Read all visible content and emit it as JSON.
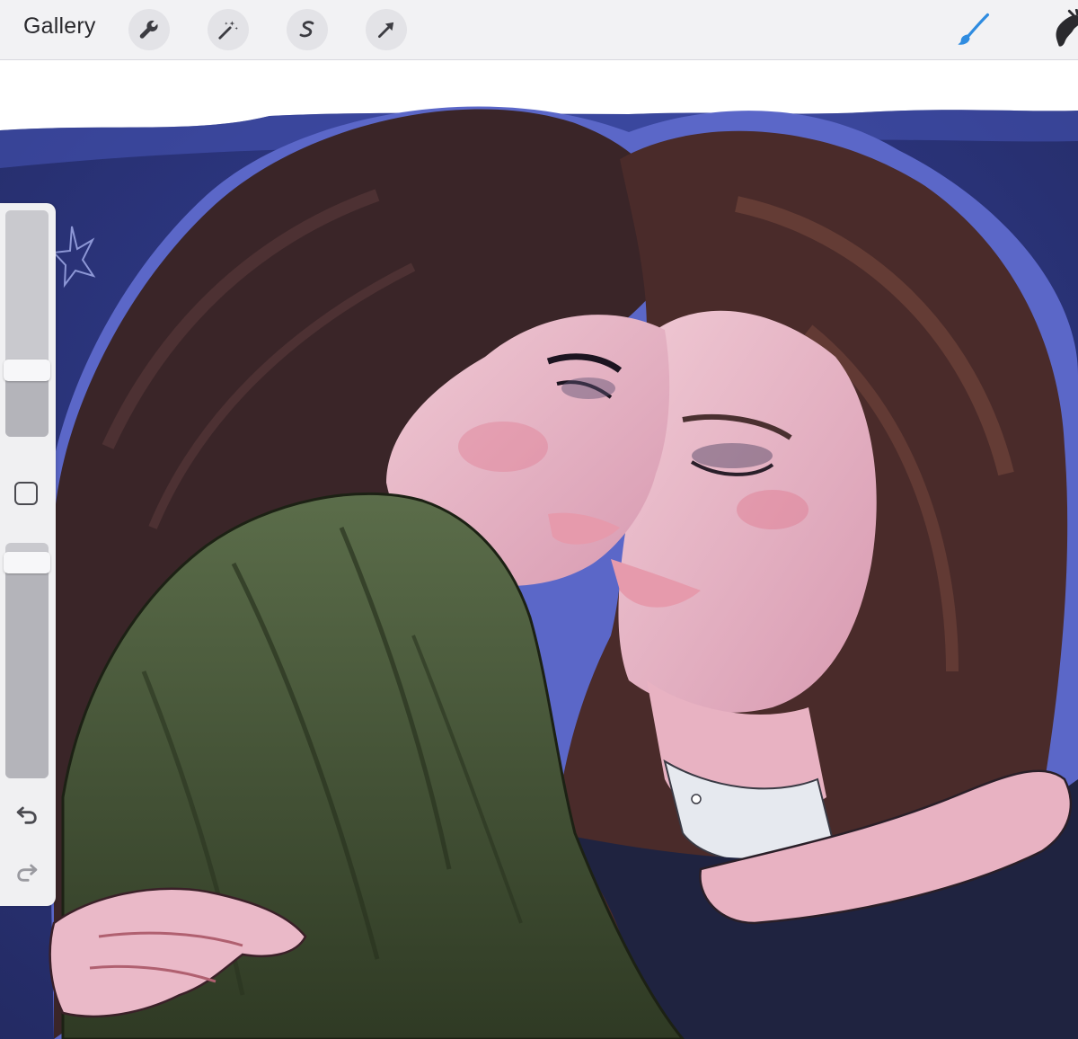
{
  "toolbar": {
    "gallery_label": "Gallery",
    "tools": [
      {
        "icon": "wrench-icon",
        "name": "actions"
      },
      {
        "icon": "magic-wand-icon",
        "name": "adjustments"
      },
      {
        "icon": "selection-s-icon",
        "name": "selection"
      },
      {
        "icon": "arrow-cursor-icon",
        "name": "transform"
      }
    ],
    "right_tools": [
      {
        "icon": "brush-icon",
        "name": "brush",
        "active": true,
        "color": "#2f8ce0"
      },
      {
        "icon": "smudge-icon",
        "name": "smudge",
        "active": false
      }
    ]
  },
  "sidebar": {
    "brush_size_level": 0.27,
    "opacity_level": 0.96,
    "modify_button_icon": "square-icon",
    "undo_icon": "undo-icon",
    "redo_icon": "redo-icon"
  },
  "canvas": {
    "background_color": "#2a3370",
    "highlight_color": "#3d4aa8",
    "star_icon": "star-doodle-icon"
  }
}
